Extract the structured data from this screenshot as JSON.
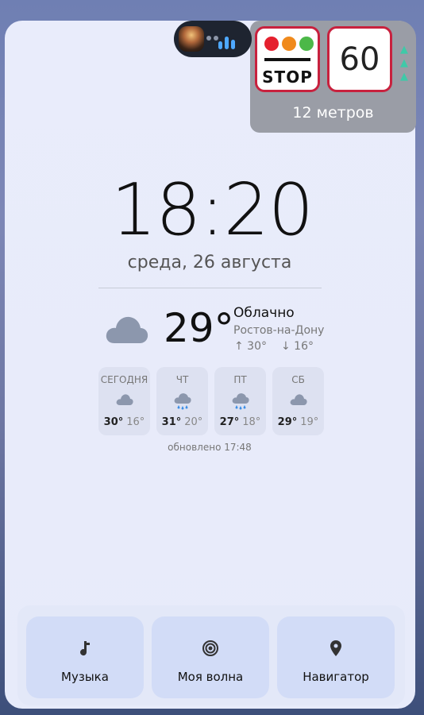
{
  "signs": {
    "stop_text": "STOP",
    "speed_limit": "60",
    "distance": "12 метров"
  },
  "clock": {
    "time": "18:20",
    "date": "среда, 26 августа"
  },
  "weather": {
    "temperature": "29°",
    "condition": "Облачно",
    "city": "Ростов-на-Дону",
    "high": "↑ 30°",
    "low": "↓ 16°",
    "forecast": [
      {
        "label": "СЕГОДНЯ",
        "hi": "30°",
        "lo": "16°",
        "icon": "cloud-icon"
      },
      {
        "label": "ЧТ",
        "hi": "31°",
        "lo": "20°",
        "icon": "rain-icon"
      },
      {
        "label": "ПТ",
        "hi": "27°",
        "lo": "18°",
        "icon": "rain-icon"
      },
      {
        "label": "СБ",
        "hi": "29°",
        "lo": "19°",
        "icon": "cloud-icon"
      }
    ],
    "updated": "обновлено 17:48"
  },
  "shortcuts": [
    {
      "label": "Музыка",
      "icon": "music-note-icon"
    },
    {
      "label": "Моя волна",
      "icon": "radio-wave-icon"
    },
    {
      "label": "Навигатор",
      "icon": "location-pin-icon"
    }
  ],
  "colors": {
    "sign_border": "#c8213e",
    "light_red": "#e5202e",
    "light_orange": "#f08a1c",
    "light_green": "#4cb848",
    "accent_blue": "#4ea8ff",
    "tile_bg": "#d2dcf7"
  }
}
